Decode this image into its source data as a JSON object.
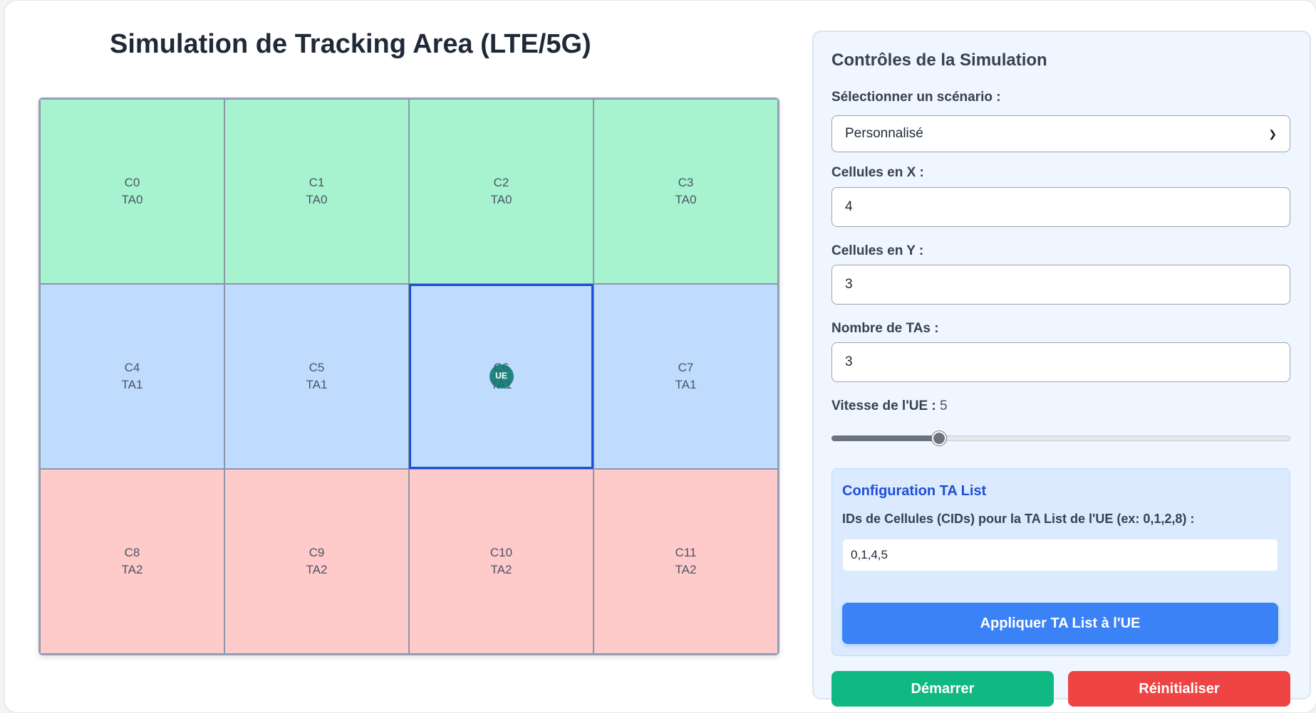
{
  "page": {
    "title": "Simulation de Tracking Area (LTE/5G)"
  },
  "colors": {
    "ta0": "#a7f3d0",
    "ta1": "#bfdbfe",
    "ta2": "#fecaca",
    "active_border": "#1d4ed8",
    "start_button": "#10b981",
    "reset_button": "#ef4444",
    "apply_button": "#3b82f6"
  },
  "grid": {
    "cols": 4,
    "rows": 3,
    "cells": [
      {
        "cid": "C0",
        "ta": "TA0",
        "ta_index": 0
      },
      {
        "cid": "C1",
        "ta": "TA0",
        "ta_index": 0
      },
      {
        "cid": "C2",
        "ta": "TA0",
        "ta_index": 0
      },
      {
        "cid": "C3",
        "ta": "TA0",
        "ta_index": 0
      },
      {
        "cid": "C4",
        "ta": "TA1",
        "ta_index": 1
      },
      {
        "cid": "C5",
        "ta": "TA1",
        "ta_index": 1
      },
      {
        "cid": "C6",
        "ta": "TA1",
        "ta_index": 1
      },
      {
        "cid": "C7",
        "ta": "TA1",
        "ta_index": 1
      },
      {
        "cid": "C8",
        "ta": "TA2",
        "ta_index": 2
      },
      {
        "cid": "C9",
        "ta": "TA2",
        "ta_index": 2
      },
      {
        "cid": "C10",
        "ta": "TA2",
        "ta_index": 2
      },
      {
        "cid": "C11",
        "ta": "TA2",
        "ta_index": 2
      }
    ],
    "active_cell_index": 6,
    "ue_label": "UE"
  },
  "controls": {
    "title": "Contrôles de la Simulation",
    "scenario_label": "Sélectionner un scénario :",
    "scenario_value": "Personnalisé",
    "cells_x_label": "Cellules en X :",
    "cells_x_value": "4",
    "cells_y_label": "Cellules en Y :",
    "cells_y_value": "3",
    "num_tas_label": "Nombre de TAs :",
    "num_tas_value": "3",
    "speed_label": "Vitesse de l'UE :",
    "speed_value": "5",
    "speed_fraction": 0.235
  },
  "ta_config": {
    "title": "Configuration TA List",
    "label": "IDs de Cellules (CIDs) pour la TA List de l'UE (ex: 0,1,2,8) :",
    "value": "0,1,4,5",
    "apply_label": "Appliquer TA List à l'UE"
  },
  "buttons": {
    "start_label": "Démarrer",
    "reset_label": "Réinitialiser"
  }
}
